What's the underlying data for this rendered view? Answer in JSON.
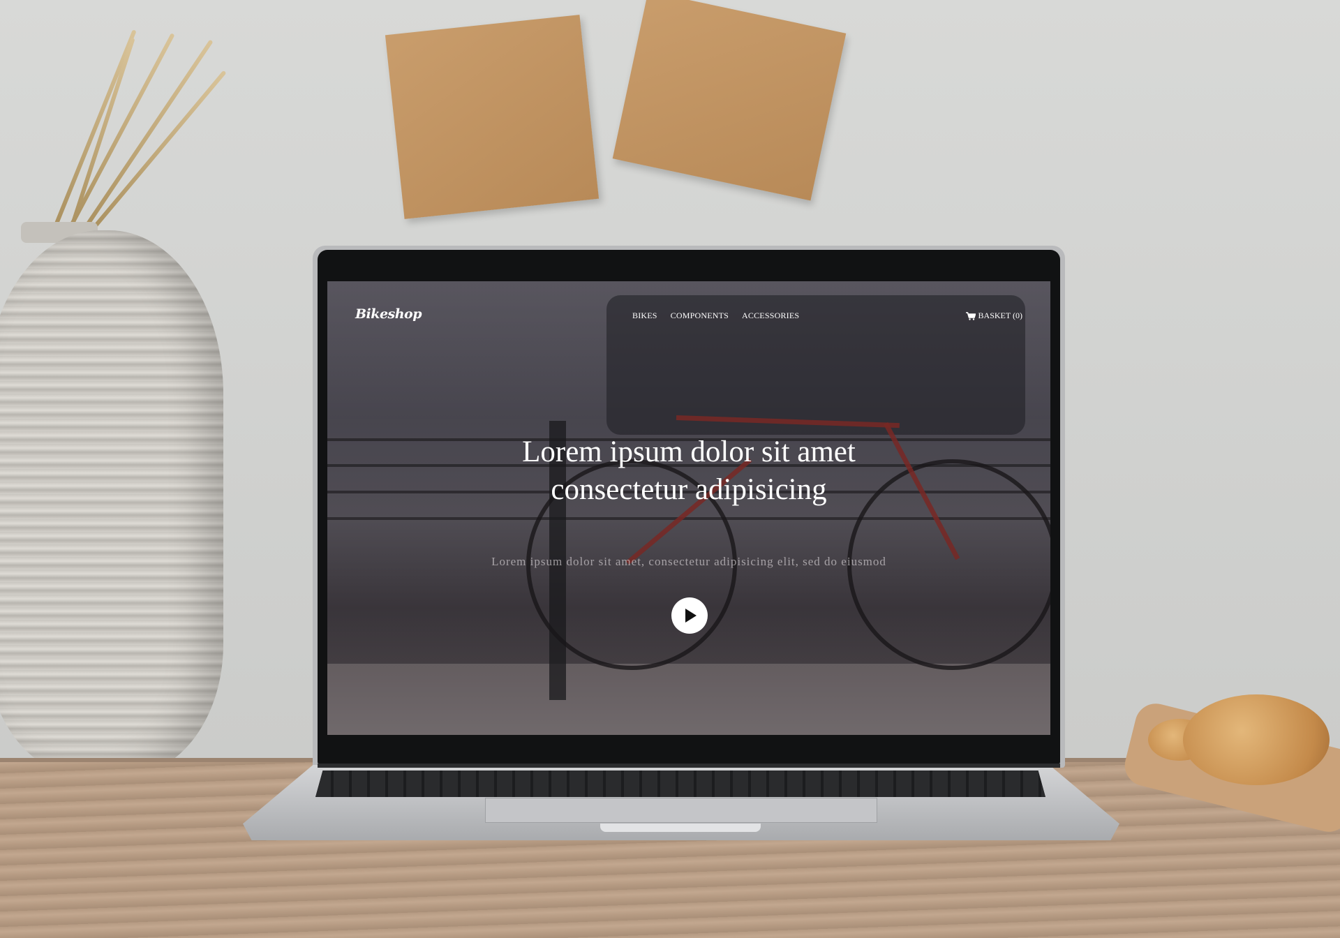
{
  "site": {
    "logo": "Bikeshop",
    "nav": [
      {
        "label": "BIKES"
      },
      {
        "label": "COMPONENTS"
      },
      {
        "label": "ACCESSORIES"
      }
    ],
    "basket": {
      "label": "BASKET (0)",
      "icon": "cart-icon"
    }
  },
  "hero": {
    "headline_line1": "Lorem ipsum dolor sit amet",
    "headline_line2": "consectetur adipisicing",
    "subline": "Lorem ipsum dolor sit amet, consectetur adipisicing elit, sed do eiusmod",
    "play_icon": "play-icon"
  },
  "colors": {
    "overlay": "#3c343e",
    "text": "#ffffff",
    "play_button_bg": "#ffffff"
  }
}
